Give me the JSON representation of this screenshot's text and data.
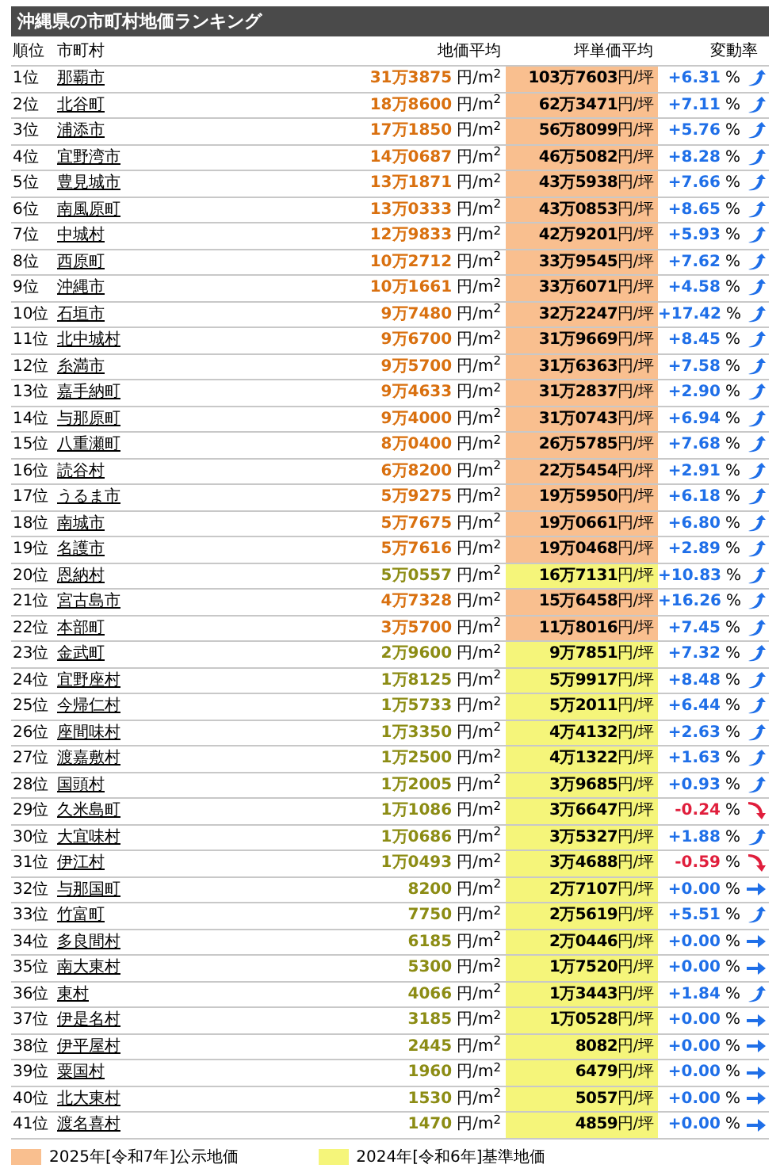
{
  "title": "沖縄県の市町村地価ランキング",
  "columns": [
    "順位",
    "市町村",
    "地価平均",
    "坪単価平均",
    "変動率"
  ],
  "rows": [
    {
      "rank": "1位",
      "name": "那覇市",
      "land_price": "31万3875",
      "land_unit": "円/m$^{2}$",
      "tsubo_price": "103万7603",
      "tsubo_unit": "円/坪",
      "change": "+6.31",
      "change_unit": "%",
      "kind": "up",
      "benchmark": false
    },
    {
      "rank": "2位",
      "name": "北谷町",
      "land_price": "18万8600",
      "land_unit": "円/m$^{2}$",
      "tsubo_price": "62万3471",
      "tsubo_unit": "円/坪",
      "change": "+7.11",
      "change_unit": "%",
      "kind": "up",
      "benchmark": false
    },
    {
      "rank": "3位",
      "name": "浦添市",
      "land_price": "17万1850",
      "land_unit": "円/m$^{2}$",
      "tsubo_price": "56万8099",
      "tsubo_unit": "円/坪",
      "change": "+5.76",
      "change_unit": "%",
      "kind": "up",
      "benchmark": false
    },
    {
      "rank": "4位",
      "name": "宜野湾市",
      "land_price": "14万0687",
      "land_unit": "円/m$^{2}$",
      "tsubo_price": "46万5082",
      "tsubo_unit": "円/坪",
      "change": "+8.28",
      "change_unit": "%",
      "kind": "up",
      "benchmark": false
    },
    {
      "rank": "5位",
      "name": "豊見城市",
      "land_price": "13万1871",
      "land_unit": "円/m$^{2}$",
      "tsubo_price": "43万5938",
      "tsubo_unit": "円/坪",
      "change": "+7.66",
      "change_unit": "%",
      "kind": "up",
      "benchmark": false
    },
    {
      "rank": "6位",
      "name": "南風原町",
      "land_price": "13万0333",
      "land_unit": "円/m$^{2}$",
      "tsubo_price": "43万0853",
      "tsubo_unit": "円/坪",
      "change": "+8.65",
      "change_unit": "%",
      "kind": "up",
      "benchmark": false
    },
    {
      "rank": "7位",
      "name": "中城村",
      "land_price": "12万9833",
      "land_unit": "円/m$^{2}$",
      "tsubo_price": "42万9201",
      "tsubo_unit": "円/坪",
      "change": "+5.93",
      "change_unit": "%",
      "kind": "up",
      "benchmark": false
    },
    {
      "rank": "8位",
      "name": "西原町",
      "land_price": "10万2712",
      "land_unit": "円/m$^{2}$",
      "tsubo_price": "33万9545",
      "tsubo_unit": "円/坪",
      "change": "+7.62",
      "change_unit": "%",
      "kind": "up",
      "benchmark": false
    },
    {
      "rank": "9位",
      "name": "沖縄市",
      "land_price": "10万1661",
      "land_unit": "円/m$^{2}$",
      "tsubo_price": "33万6071",
      "tsubo_unit": "円/坪",
      "change": "+4.58",
      "change_unit": "%",
      "kind": "up",
      "benchmark": false
    },
    {
      "rank": "10位",
      "name": "石垣市",
      "land_price": "9万7480",
      "land_unit": "円/m$^{2}$",
      "tsubo_price": "32万2247",
      "tsubo_unit": "円/坪",
      "change": "+17.42",
      "change_unit": "%",
      "kind": "up",
      "benchmark": false
    },
    {
      "rank": "11位",
      "name": "北中城村",
      "land_price": "9万6700",
      "land_unit": "円/m$^{2}$",
      "tsubo_price": "31万9669",
      "tsubo_unit": "円/坪",
      "change": "+8.45",
      "change_unit": "%",
      "kind": "up",
      "benchmark": false
    },
    {
      "rank": "12位",
      "name": "糸満市",
      "land_price": "9万5700",
      "land_unit": "円/m$^{2}$",
      "tsubo_price": "31万6363",
      "tsubo_unit": "円/坪",
      "change": "+7.58",
      "change_unit": "%",
      "kind": "up",
      "benchmark": false
    },
    {
      "rank": "13位",
      "name": "嘉手納町",
      "land_price": "9万4633",
      "land_unit": "円/m$^{2}$",
      "tsubo_price": "31万2837",
      "tsubo_unit": "円/坪",
      "change": "+2.90",
      "change_unit": "%",
      "kind": "up",
      "benchmark": false
    },
    {
      "rank": "14位",
      "name": "与那原町",
      "land_price": "9万4000",
      "land_unit": "円/m$^{2}$",
      "tsubo_price": "31万0743",
      "tsubo_unit": "円/坪",
      "change": "+6.94",
      "change_unit": "%",
      "kind": "up",
      "benchmark": false
    },
    {
      "rank": "15位",
      "name": "八重瀬町",
      "land_price": "8万0400",
      "land_unit": "円/m$^{2}$",
      "tsubo_price": "26万5785",
      "tsubo_unit": "円/坪",
      "change": "+7.68",
      "change_unit": "%",
      "kind": "up",
      "benchmark": false
    },
    {
      "rank": "16位",
      "name": "読谷村",
      "land_price": "6万8200",
      "land_unit": "円/m$^{2}$",
      "tsubo_price": "22万5454",
      "tsubo_unit": "円/坪",
      "change": "+2.91",
      "change_unit": "%",
      "kind": "up",
      "benchmark": false
    },
    {
      "rank": "17位",
      "name": "うるま市",
      "land_price": "5万9275",
      "land_unit": "円/m$^{2}$",
      "tsubo_price": "19万5950",
      "tsubo_unit": "円/坪",
      "change": "+6.18",
      "change_unit": "%",
      "kind": "up",
      "benchmark": false
    },
    {
      "rank": "18位",
      "name": "南城市",
      "land_price": "5万7675",
      "land_unit": "円/m$^{2}$",
      "tsubo_price": "19万0661",
      "tsubo_unit": "円/坪",
      "change": "+6.80",
      "change_unit": "%",
      "kind": "up",
      "benchmark": false
    },
    {
      "rank": "19位",
      "name": "名護市",
      "land_price": "5万7616",
      "land_unit": "円/m$^{2}$",
      "tsubo_price": "19万0468",
      "tsubo_unit": "円/坪",
      "change": "+2.89",
      "change_unit": "%",
      "kind": "up",
      "benchmark": false
    },
    {
      "rank": "20位",
      "name": "恩納村",
      "land_price": "5万0557",
      "land_unit": "円/m$^{2}$",
      "tsubo_price": "16万7131",
      "tsubo_unit": "円/坪",
      "change": "+10.83",
      "change_unit": "%",
      "kind": "up",
      "benchmark": true
    },
    {
      "rank": "21位",
      "name": "宮古島市",
      "land_price": "4万7328",
      "land_unit": "円/m$^{2}$",
      "tsubo_price": "15万6458",
      "tsubo_unit": "円/坪",
      "change": "+16.26",
      "change_unit": "%",
      "kind": "up",
      "benchmark": false
    },
    {
      "rank": "22位",
      "name": "本部町",
      "land_price": "3万5700",
      "land_unit": "円/m$^{2}$",
      "tsubo_price": "11万8016",
      "tsubo_unit": "円/坪",
      "change": "+7.45",
      "change_unit": "%",
      "kind": "up",
      "benchmark": false
    },
    {
      "rank": "23位",
      "name": "金武町",
      "land_price": "2万9600",
      "land_unit": "円/m$^{2}$",
      "tsubo_price": "9万7851",
      "tsubo_unit": "円/坪",
      "change": "+7.32",
      "change_unit": "%",
      "kind": "up",
      "benchmark": true
    },
    {
      "rank": "24位",
      "name": "宜野座村",
      "land_price": "1万8125",
      "land_unit": "円/m$^{2}$",
      "tsubo_price": "5万9917",
      "tsubo_unit": "円/坪",
      "change": "+8.48",
      "change_unit": "%",
      "kind": "up",
      "benchmark": true
    },
    {
      "rank": "25位",
      "name": "今帰仁村",
      "land_price": "1万5733",
      "land_unit": "円/m$^{2}$",
      "tsubo_price": "5万2011",
      "tsubo_unit": "円/坪",
      "change": "+6.44",
      "change_unit": "%",
      "kind": "up",
      "benchmark": true
    },
    {
      "rank": "26位",
      "name": "座間味村",
      "land_price": "1万3350",
      "land_unit": "円/m$^{2}$",
      "tsubo_price": "4万4132",
      "tsubo_unit": "円/坪",
      "change": "+2.63",
      "change_unit": "%",
      "kind": "up",
      "benchmark": true
    },
    {
      "rank": "27位",
      "name": "渡嘉敷村",
      "land_price": "1万2500",
      "land_unit": "円/m$^{2}$",
      "tsubo_price": "4万1322",
      "tsubo_unit": "円/坪",
      "change": "+1.63",
      "change_unit": "%",
      "kind": "up",
      "benchmark": true
    },
    {
      "rank": "28位",
      "name": "国頭村",
      "land_price": "1万2005",
      "land_unit": "円/m$^{2}$",
      "tsubo_price": "3万9685",
      "tsubo_unit": "円/坪",
      "change": "+0.93",
      "change_unit": "%",
      "kind": "up",
      "benchmark": true
    },
    {
      "rank": "29位",
      "name": "久米島町",
      "land_price": "1万1086",
      "land_unit": "円/m$^{2}$",
      "tsubo_price": "3万6647",
      "tsubo_unit": "円/坪",
      "change": "-0.24",
      "change_unit": "%",
      "kind": "down",
      "benchmark": true
    },
    {
      "rank": "30位",
      "name": "大宜味村",
      "land_price": "1万0686",
      "land_unit": "円/m$^{2}$",
      "tsubo_price": "3万5327",
      "tsubo_unit": "円/坪",
      "change": "+1.88",
      "change_unit": "%",
      "kind": "up",
      "benchmark": true
    },
    {
      "rank": "31位",
      "name": "伊江村",
      "land_price": "1万0493",
      "land_unit": "円/m$^{2}$",
      "tsubo_price": "3万4688",
      "tsubo_unit": "円/坪",
      "change": "-0.59",
      "change_unit": "%",
      "kind": "down",
      "benchmark": true
    },
    {
      "rank": "32位",
      "name": "与那国町",
      "land_price": "8200",
      "land_unit": "円/m$^{2}$",
      "tsubo_price": "2万7107",
      "tsubo_unit": "円/坪",
      "change": "+0.00",
      "change_unit": "%",
      "kind": "flat",
      "benchmark": true
    },
    {
      "rank": "33位",
      "name": "竹富町",
      "land_price": "7750",
      "land_unit": "円/m$^{2}$",
      "tsubo_price": "2万5619",
      "tsubo_unit": "円/坪",
      "change": "+5.51",
      "change_unit": "%",
      "kind": "up",
      "benchmark": true
    },
    {
      "rank": "34位",
      "name": "多良間村",
      "land_price": "6185",
      "land_unit": "円/m$^{2}$",
      "tsubo_price": "2万0446",
      "tsubo_unit": "円/坪",
      "change": "+0.00",
      "change_unit": "%",
      "kind": "flat",
      "benchmark": true
    },
    {
      "rank": "35位",
      "name": "南大東村",
      "land_price": "5300",
      "land_unit": "円/m$^{2}$",
      "tsubo_price": "1万7520",
      "tsubo_unit": "円/坪",
      "change": "+0.00",
      "change_unit": "%",
      "kind": "flat",
      "benchmark": true
    },
    {
      "rank": "36位",
      "name": "東村",
      "land_price": "4066",
      "land_unit": "円/m$^{2}$",
      "tsubo_price": "1万3443",
      "tsubo_unit": "円/坪",
      "change": "+1.84",
      "change_unit": "%",
      "kind": "up",
      "benchmark": true
    },
    {
      "rank": "37位",
      "name": "伊是名村",
      "land_price": "3185",
      "land_unit": "円/m$^{2}$",
      "tsubo_price": "1万0528",
      "tsubo_unit": "円/坪",
      "change": "+0.00",
      "change_unit": "%",
      "kind": "flat",
      "benchmark": true
    },
    {
      "rank": "38位",
      "name": "伊平屋村",
      "land_price": "2445",
      "land_unit": "円/m$^{2}$",
      "tsubo_price": "8082",
      "tsubo_unit": "円/坪",
      "change": "+0.00",
      "change_unit": "%",
      "kind": "flat",
      "benchmark": true
    },
    {
      "rank": "39位",
      "name": "粟国村",
      "land_price": "1960",
      "land_unit": "円/m$^{2}$",
      "tsubo_price": "6479",
      "tsubo_unit": "円/坪",
      "change": "+0.00",
      "change_unit": "%",
      "kind": "flat",
      "benchmark": true
    },
    {
      "rank": "40位",
      "name": "北大東村",
      "land_price": "1530",
      "land_unit": "円/m$^{2}$",
      "tsubo_price": "5057",
      "tsubo_unit": "円/坪",
      "change": "+0.00",
      "change_unit": "%",
      "kind": "flat",
      "benchmark": true
    },
    {
      "rank": "41位",
      "name": "渡名喜村",
      "land_price": "1470",
      "land_unit": "円/m$^{2}$",
      "tsubo_price": "4859",
      "tsubo_unit": "円/坪",
      "change": "+0.00",
      "change_unit": "%",
      "kind": "flat",
      "benchmark": true
    }
  ],
  "legend": [
    {
      "label": "2025年[令和7年]公示地価",
      "color": "#f9bf8f"
    },
    {
      "label": "2024年[令和6年]基準地価",
      "color": "#f5f57a"
    }
  ]
}
